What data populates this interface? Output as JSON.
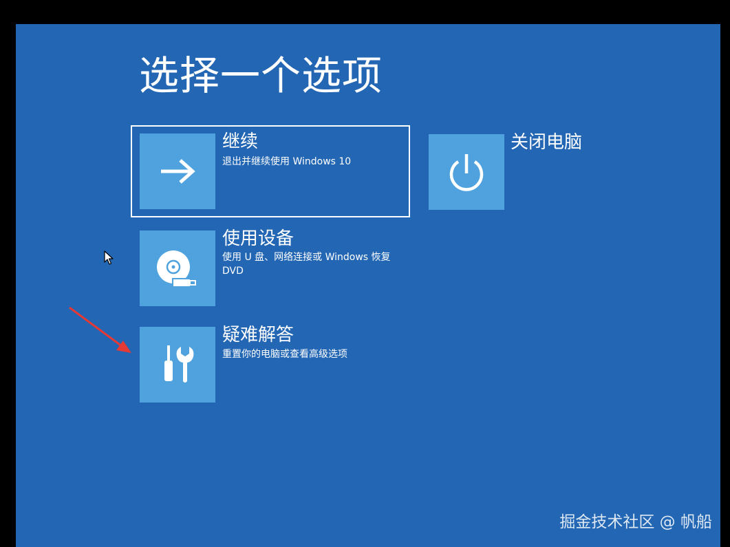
{
  "page": {
    "title": "选择一个选项"
  },
  "options": [
    {
      "title": "继续",
      "description": "退出并继续使用 Windows 10",
      "icon": "arrow-right-icon"
    },
    {
      "title": "关闭电脑",
      "description": "",
      "icon": "power-icon"
    },
    {
      "title": "使用设备",
      "description": "使用 U 盘、网络连接或 Windows 恢复 DVD",
      "icon": "disc-usb-icon"
    },
    {
      "title": "疑难解答",
      "description": "重置你的电脑或查看高级选项",
      "icon": "tools-icon"
    }
  ],
  "watermark": "掘金技术社区 @ 帆船",
  "colors": {
    "background": "#2266b4",
    "tile": "#4fa2dd",
    "text": "#ffffff",
    "annotation_arrow": "#e53935",
    "outer_frame": "#000000"
  }
}
